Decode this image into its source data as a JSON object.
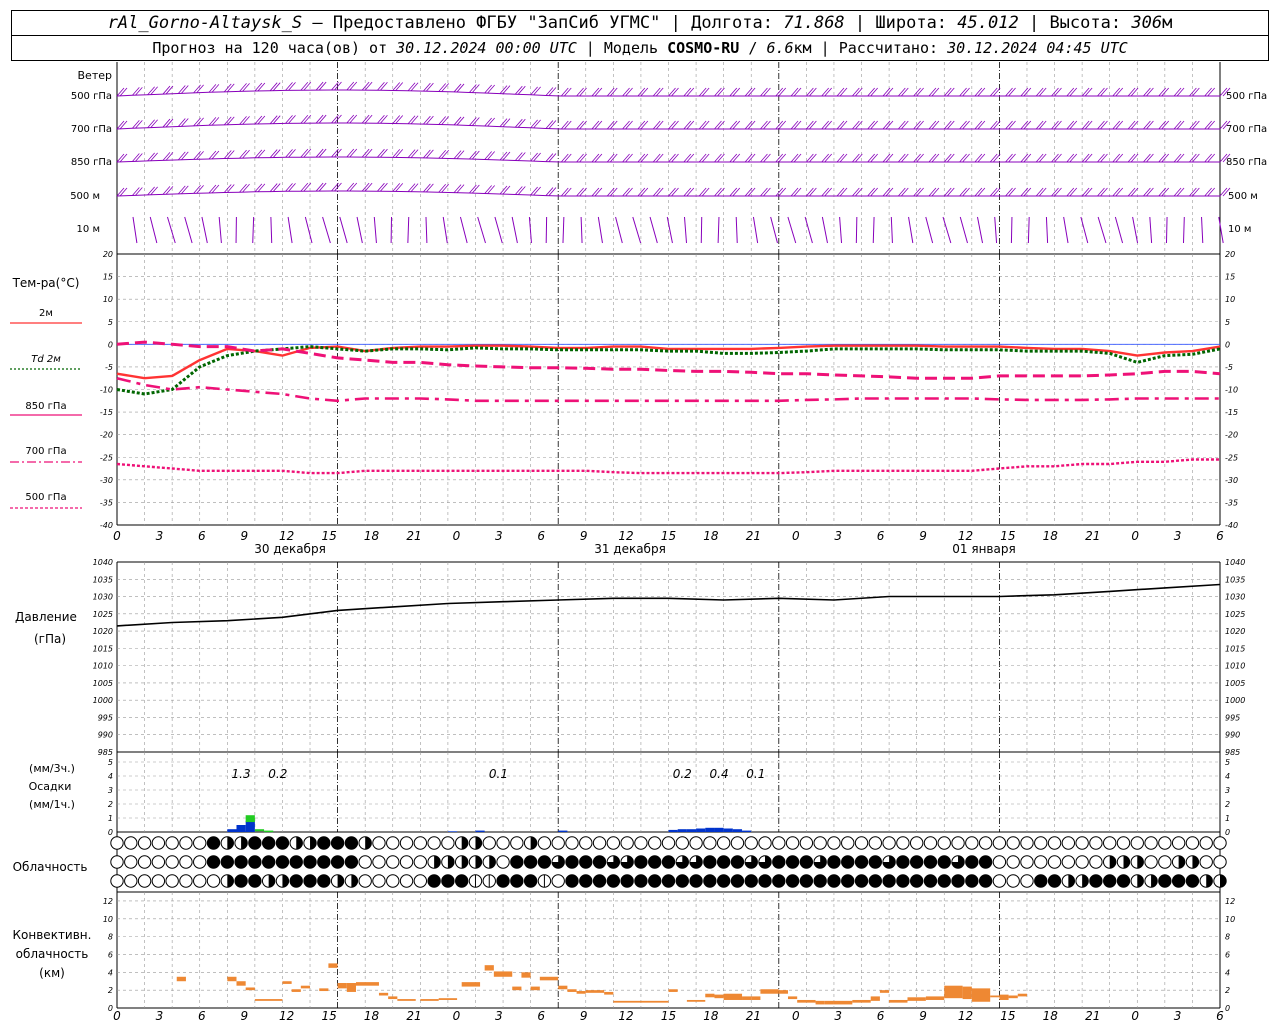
{
  "header": {
    "station": "rAl_Gorno-Altaysk_S",
    "provider": "Предоставлено ФГБУ \"ЗапСиб УГМС\"",
    "lon_label": "Долгота:",
    "lon_value": "71.868",
    "lat_label": "Широта:",
    "lat_value": "45.012",
    "alt_label": "Высота:",
    "alt_value": "306",
    "alt_unit": "м",
    "forecast_prefix": "Прогноз на 120 часа(ов) от",
    "forecast_from": "30.12.2024 00:00 UTC",
    "model_label": "Модель",
    "model_name": "COSMO-RU",
    "model_res": "6.6",
    "model_res_unit": "км",
    "calc_label": "Рассчитано:",
    "calc_time": "30.12.2024 04:45 UTC"
  },
  "axis_hours": [
    "0",
    "3",
    "6",
    "9",
    "12",
    "15",
    "18",
    "21",
    "0",
    "3",
    "6",
    "9",
    "12",
    "15",
    "18",
    "21",
    "0",
    "3",
    "6",
    "9",
    "12",
    "15",
    "18",
    "21",
    "0",
    "3",
    "6"
  ],
  "day_labels": [
    "30 декабря",
    "31 декабря",
    "01 января"
  ],
  "wind_panel": {
    "title": "Ветер",
    "levels": [
      "500 гПа",
      "700 гПа",
      "850 гПа",
      "500 м",
      "10 м"
    ],
    "color": "#8800bb"
  },
  "temp_panel": {
    "title": "Тем-ра(°С)",
    "legend": [
      "2м",
      "Td 2м",
      "850 гПа",
      "700 гПа",
      "500 гПа"
    ],
    "yticks": [
      "20",
      "15",
      "10",
      "5",
      "0",
      "-5",
      "-10",
      "-15",
      "-20",
      "-25",
      "-30",
      "-35",
      "-40"
    ]
  },
  "pressure_panel": {
    "title": "Давление",
    "unit": "(гПа)",
    "yticks": [
      "1040",
      "1035",
      "1030",
      "1025",
      "1020",
      "1015",
      "1010",
      "1005",
      "1000",
      "995",
      "990",
      "985"
    ]
  },
  "precip_panel": {
    "unit3h": "(мм/3ч.)",
    "title": "Осадки",
    "unit1h": "(мм/1ч.)",
    "yticks": [
      "5",
      "4",
      "3",
      "2",
      "1",
      "0"
    ],
    "totals": [
      {
        "hour": 13.5,
        "text": "1.3"
      },
      {
        "hour": 17.5,
        "text": "0.2"
      },
      {
        "hour": 41.5,
        "text": "0.1"
      },
      {
        "hour": 61.5,
        "text": "0.2"
      },
      {
        "hour": 65.5,
        "text": "0.4"
      },
      {
        "hour": 69.5,
        "text": "0.1"
      }
    ]
  },
  "cloud_panel": {
    "title": "Облачность"
  },
  "conv_panel": {
    "title1": "Конвективн.",
    "title2": "облачность",
    "unit": "(км)",
    "yticks": [
      "12",
      "10",
      "8",
      "6",
      "4",
      "2",
      "0"
    ]
  },
  "colors": {
    "t2m": "#ff3333",
    "td2m": "#006600",
    "t850": "#ee1177",
    "t700": "#ee1177",
    "t500": "#ee1177",
    "pressure": "#000000",
    "precip_blue": "#0033cc",
    "precip_green": "#22cc22",
    "conv": "#ee8833"
  },
  "chart_data": [
    {
      "type": "line",
      "title": "Тем-ра(°С)",
      "ylim": [
        -40,
        20
      ],
      "x_hours": [
        0,
        3,
        6,
        9,
        12,
        15,
        18,
        21,
        24,
        27,
        30,
        33,
        36,
        39,
        42,
        45,
        48,
        51,
        54,
        57,
        60,
        63,
        66,
        69,
        72,
        75,
        78,
        81,
        84,
        87,
        90,
        93,
        96,
        99,
        102,
        105,
        108,
        111,
        114,
        117,
        120
      ],
      "series": [
        {
          "name": "2м",
          "values": [
            -6.5,
            -7.5,
            -7,
            -3.5,
            -1,
            -1.5,
            -2.5,
            -0.8,
            -0.5,
            -1.5,
            -0.8,
            -0.5,
            -0.5,
            -0.3,
            -0.3,
            -0.5,
            -0.8,
            -0.8,
            -0.5,
            -0.5,
            -1,
            -1,
            -1,
            -1,
            -0.8,
            -0.5,
            -0.3,
            -0.3,
            -0.3,
            -0.3,
            -0.5,
            -0.5,
            -0.5,
            -0.8,
            -1,
            -1,
            -1.5,
            -2.5,
            -1.8,
            -1.5,
            -0.5
          ]
        },
        {
          "name": "Td 2м",
          "values": [
            -10,
            -11,
            -10,
            -5,
            -2.5,
            -1.5,
            -1,
            -0.5,
            -1,
            -1.5,
            -1,
            -1,
            -1.2,
            -0.8,
            -1,
            -1,
            -1.2,
            -1.2,
            -1.2,
            -1.2,
            -1.5,
            -1.5,
            -2,
            -2,
            -1.8,
            -1.5,
            -1,
            -1,
            -1,
            -1,
            -1.2,
            -1.2,
            -1.2,
            -1.5,
            -1.5,
            -1.5,
            -2,
            -4,
            -2.5,
            -2.2,
            -1
          ]
        },
        {
          "name": "850 гПа",
          "values": [
            0,
            0.5,
            0,
            -0.5,
            -0.5,
            -1.5,
            -1,
            -2,
            -3,
            -3.5,
            -4,
            -4,
            -4.5,
            -4.8,
            -5,
            -5.2,
            -5.2,
            -5.3,
            -5.5,
            -5.5,
            -5.8,
            -6,
            -6,
            -6.2,
            -6.5,
            -6.5,
            -6.8,
            -7,
            -7.2,
            -7.5,
            -7.5,
            -7.5,
            -7,
            -7,
            -7,
            -7,
            -6.8,
            -6.5,
            -6,
            -6,
            -6.5
          ]
        },
        {
          "name": "700 гПа",
          "values": [
            -7.5,
            -9,
            -10,
            -9.5,
            -10,
            -10.5,
            -11,
            -12,
            -12.5,
            -12,
            -12,
            -12,
            -12.2,
            -12.5,
            -12.5,
            -12.5,
            -12.5,
            -12.5,
            -12.5,
            -12.5,
            -12.5,
            -12.5,
            -12.5,
            -12.5,
            -12.5,
            -12.3,
            -12.2,
            -12,
            -12,
            -12,
            -12,
            -12,
            -12.2,
            -12.3,
            -12.3,
            -12.3,
            -12.2,
            -12,
            -12,
            -12,
            -12
          ]
        },
        {
          "name": "500 гПа",
          "values": [
            -26.5,
            -27,
            -27.5,
            -28,
            -28,
            -28,
            -28,
            -28.5,
            -28.5,
            -28,
            -28,
            -28,
            -28,
            -28,
            -28,
            -28,
            -28,
            -28,
            -28.3,
            -28.5,
            -28.5,
            -28.5,
            -28.5,
            -28.5,
            -28.5,
            -28.3,
            -28,
            -28,
            -28,
            -28,
            -28,
            -28,
            -27.5,
            -27,
            -27,
            -26.5,
            -26.5,
            -26,
            -26,
            -25.5,
            -25.5
          ]
        }
      ]
    },
    {
      "type": "line",
      "title": "Давление",
      "ylim": [
        985,
        1040
      ],
      "x_hours": [
        0,
        6,
        12,
        18,
        24,
        30,
        36,
        42,
        48,
        54,
        60,
        66,
        72,
        78,
        84,
        90,
        96,
        102,
        108,
        114,
        120
      ],
      "series": [
        {
          "name": "Давление",
          "values": [
            1021.5,
            1022.5,
            1023,
            1024,
            1026,
            1027,
            1028,
            1028.5,
            1029,
            1029.5,
            1029.5,
            1029,
            1029.5,
            1029,
            1030,
            1030,
            1030,
            1030.5,
            1031.5,
            1032.5,
            1033.5
          ]
        }
      ]
    },
    {
      "type": "bar",
      "title": "Осадки",
      "ylim": [
        0,
        5
      ],
      "series": [
        {
          "name": "мм/1ч.",
          "bars": [
            {
              "h": 12,
              "v": 0.2
            },
            {
              "h": 13,
              "v": 0.5
            },
            {
              "h": 14,
              "v": 0.8
            },
            {
              "h": 36,
              "v": 0.05
            },
            {
              "h": 39,
              "v": 0.1
            },
            {
              "h": 48,
              "v": 0.1
            },
            {
              "h": 60,
              "v": 0.15
            },
            {
              "h": 61,
              "v": 0.2
            },
            {
              "h": 62,
              "v": 0.2
            },
            {
              "h": 63,
              "v": 0.25
            },
            {
              "h": 64,
              "v": 0.3
            },
            {
              "h": 65,
              "v": 0.3
            },
            {
              "h": 66,
              "v": 0.25
            },
            {
              "h": 67,
              "v": 0.2
            },
            {
              "h": 68,
              "v": 0.1
            }
          ]
        },
        {
          "name": "мм/3ч.",
          "bars": [
            {
              "h": 14,
              "v": 1.2
            },
            {
              "h": 15,
              "v": 0.2
            },
            {
              "h": 16,
              "v": 0.1
            }
          ]
        }
      ]
    },
    {
      "type": "bar",
      "title": "Конвективн. облачность (км)",
      "ylim": [
        0,
        13
      ],
      "bars": [
        {
          "h0": 6.5,
          "h1": 7.5,
          "base": 3.0,
          "top": 3.5
        },
        {
          "h0": 12,
          "h1": 13,
          "base": 3.0,
          "top": 3.5
        },
        {
          "h0": 13,
          "h1": 14,
          "base": 2.5,
          "top": 3.0
        },
        {
          "h0": 14,
          "h1": 15,
          "base": 2.0,
          "top": 2.3
        },
        {
          "h0": 15,
          "h1": 18,
          "base": 0.8,
          "top": 1.0
        },
        {
          "h0": 18,
          "h1": 19,
          "base": 2.7,
          "top": 3.0
        },
        {
          "h0": 19,
          "h1": 20,
          "base": 1.8,
          "top": 2.1
        },
        {
          "h0": 20,
          "h1": 21,
          "base": 2.2,
          "top": 2.5
        },
        {
          "h0": 22,
          "h1": 23,
          "base": 1.9,
          "top": 2.2
        },
        {
          "h0": 23,
          "h1": 24,
          "base": 4.5,
          "top": 5.0
        },
        {
          "h0": 24,
          "h1": 25,
          "base": 2.2,
          "top": 2.8
        },
        {
          "h0": 25,
          "h1": 26,
          "base": 1.8,
          "top": 2.8
        },
        {
          "h0": 26,
          "h1": 28.5,
          "base": 2.5,
          "top": 2.9
        },
        {
          "h0": 28.5,
          "h1": 29.5,
          "base": 1.4,
          "top": 1.7
        },
        {
          "h0": 29.5,
          "h1": 30.5,
          "base": 1.0,
          "top": 1.3
        },
        {
          "h0": 30.5,
          "h1": 32.5,
          "base": 0.8,
          "top": 1.0
        },
        {
          "h0": 33,
          "h1": 35,
          "base": 0.8,
          "top": 1.0
        },
        {
          "h0": 35,
          "h1": 37,
          "base": 0.9,
          "top": 1.1
        },
        {
          "h0": 37.5,
          "h1": 39.5,
          "base": 2.4,
          "top": 2.9
        },
        {
          "h0": 40,
          "h1": 41,
          "base": 4.2,
          "top": 4.8
        },
        {
          "h0": 41,
          "h1": 43,
          "base": 3.5,
          "top": 4.1
        },
        {
          "h0": 43,
          "h1": 44,
          "base": 2.0,
          "top": 2.4
        },
        {
          "h0": 44,
          "h1": 45,
          "base": 3.4,
          "top": 4.0
        },
        {
          "h0": 45,
          "h1": 46,
          "base": 2.0,
          "top": 2.4
        },
        {
          "h0": 46,
          "h1": 48,
          "base": 3.1,
          "top": 3.5
        },
        {
          "h0": 48,
          "h1": 49,
          "base": 2.1,
          "top": 2.5
        },
        {
          "h0": 49,
          "h1": 50,
          "base": 1.8,
          "top": 2.1
        },
        {
          "h0": 50,
          "h1": 51,
          "base": 1.6,
          "top": 1.9
        },
        {
          "h0": 51,
          "h1": 53,
          "base": 1.7,
          "top": 2.0
        },
        {
          "h0": 53,
          "h1": 54,
          "base": 1.5,
          "top": 1.8
        },
        {
          "h0": 54,
          "h1": 60,
          "base": 0.6,
          "top": 0.8
        },
        {
          "h0": 60,
          "h1": 61,
          "base": 1.8,
          "top": 2.1
        },
        {
          "h0": 62,
          "h1": 63,
          "base": 0.7,
          "top": 0.9
        },
        {
          "h0": 63,
          "h1": 64,
          "base": 0.7,
          "top": 0.9
        },
        {
          "h0": 64,
          "h1": 65,
          "base": 1.2,
          "top": 1.6
        },
        {
          "h0": 65,
          "h1": 66,
          "base": 1.1,
          "top": 1.5
        },
        {
          "h0": 66,
          "h1": 68,
          "base": 0.9,
          "top": 1.6
        },
        {
          "h0": 68,
          "h1": 69,
          "base": 0.9,
          "top": 1.3
        },
        {
          "h0": 69,
          "h1": 70,
          "base": 0.9,
          "top": 1.3
        },
        {
          "h0": 70,
          "h1": 72,
          "base": 1.6,
          "top": 2.1
        },
        {
          "h0": 72,
          "h1": 73,
          "base": 1.6,
          "top": 2.0
        },
        {
          "h0": 73,
          "h1": 74,
          "base": 1.0,
          "top": 1.3
        },
        {
          "h0": 74,
          "h1": 75,
          "base": 0.6,
          "top": 0.9
        },
        {
          "h0": 75,
          "h1": 76,
          "base": 0.6,
          "top": 0.9
        },
        {
          "h0": 76,
          "h1": 77,
          "base": 0.4,
          "top": 0.8
        },
        {
          "h0": 77,
          "h1": 78,
          "base": 0.4,
          "top": 0.8
        },
        {
          "h0": 78,
          "h1": 80,
          "base": 0.4,
          "top": 0.8
        },
        {
          "h0": 80,
          "h1": 81,
          "base": 0.6,
          "top": 0.9
        },
        {
          "h0": 81,
          "h1": 82,
          "base": 0.6,
          "top": 0.9
        },
        {
          "h0": 82,
          "h1": 83,
          "base": 0.8,
          "top": 1.3
        },
        {
          "h0": 83,
          "h1": 84,
          "base": 1.7,
          "top": 2.0
        },
        {
          "h0": 84,
          "h1": 86,
          "base": 0.6,
          "top": 0.9
        },
        {
          "h0": 86,
          "h1": 88,
          "base": 0.8,
          "top": 1.2
        },
        {
          "h0": 88,
          "h1": 90,
          "base": 0.9,
          "top": 1.3
        },
        {
          "h0": 90,
          "h1": 92,
          "base": 1.1,
          "top": 2.5
        },
        {
          "h0": 92,
          "h1": 93,
          "base": 1.0,
          "top": 2.4
        },
        {
          "h0": 93,
          "h1": 95,
          "base": 0.7,
          "top": 2.2
        },
        {
          "h0": 95,
          "h1": 96,
          "base": 1.2,
          "top": 1.4
        },
        {
          "h0": 96,
          "h1": 97,
          "base": 0.9,
          "top": 1.5
        },
        {
          "h0": 97,
          "h1": 98,
          "base": 1.1,
          "top": 1.4
        },
        {
          "h0": 98,
          "h1": 99,
          "base": 1.3,
          "top": 1.6
        }
      ]
    }
  ]
}
